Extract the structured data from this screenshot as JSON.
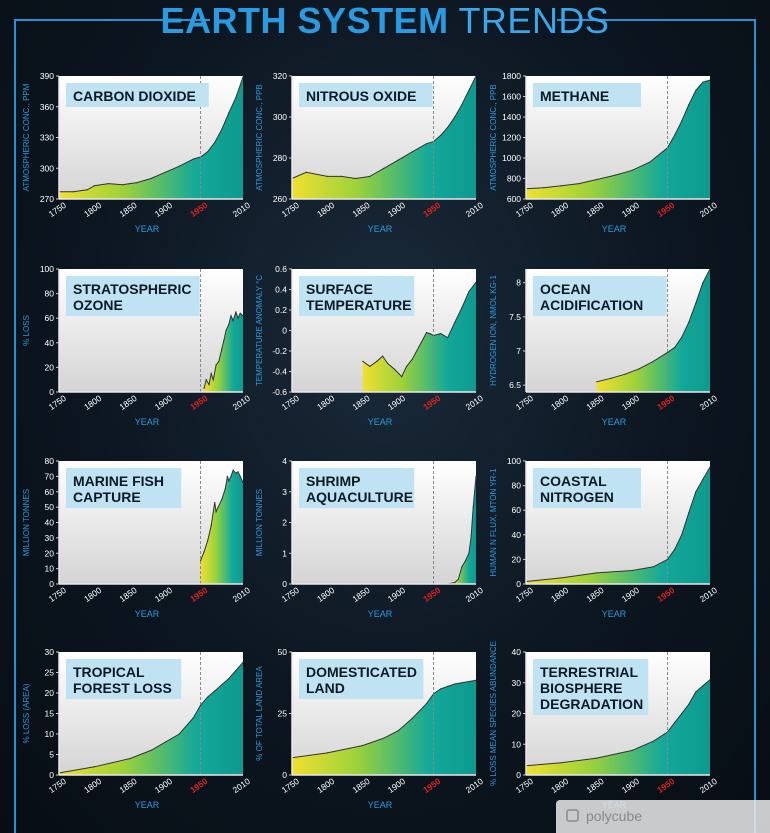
{
  "title_bold": "EARTH SYSTEM",
  "title_light": "TRENDS",
  "xlabel": "YEAR",
  "watermark": "polycube",
  "colors": {
    "accent": "#2e8fd0",
    "area_teal": "#12a89a",
    "area_yellow": "#f0e030",
    "highlight_year": "#e02020",
    "label_blue": "#2a9be0"
  },
  "chart_data": [
    {
      "type": "area",
      "title": [
        "CARBON DIOXIDE"
      ],
      "ylabel": "ATMOSPHERIC CONC., PPM",
      "xlim": [
        1750,
        2010
      ],
      "ylim": [
        270,
        390
      ],
      "yticks": [
        270,
        300,
        330,
        360,
        390
      ],
      "xticks": [
        1750,
        1800,
        1850,
        1900,
        1950,
        2010
      ],
      "x": [
        1750,
        1770,
        1790,
        1800,
        1820,
        1840,
        1860,
        1880,
        1900,
        1920,
        1940,
        1950,
        1960,
        1970,
        1980,
        1990,
        2000,
        2010
      ],
      "y": [
        277,
        277,
        279,
        283,
        285,
        284,
        286,
        290,
        296,
        302,
        309,
        311,
        316,
        325,
        338,
        354,
        369,
        389
      ]
    },
    {
      "type": "area",
      "title": [
        "NITROUS OXIDE"
      ],
      "ylabel": "ATMOSPHERIC CONC., PPB",
      "xlim": [
        1750,
        2010
      ],
      "ylim": [
        260,
        320
      ],
      "yticks": [
        260,
        280,
        300,
        320
      ],
      "xticks": [
        1750,
        1800,
        1850,
        1900,
        1950,
        2010
      ],
      "x": [
        1750,
        1770,
        1800,
        1820,
        1840,
        1860,
        1880,
        1900,
        1920,
        1940,
        1950,
        1960,
        1970,
        1980,
        1990,
        2000,
        2010
      ],
      "y": [
        270,
        273,
        271,
        271,
        270,
        271,
        275,
        279,
        283,
        287,
        288,
        291,
        295,
        300,
        306,
        313,
        322
      ]
    },
    {
      "type": "area",
      "title": [
        "METHANE"
      ],
      "ylabel": "ATMOSPHERIC CONC., PPB",
      "xlim": [
        1750,
        2010
      ],
      "ylim": [
        600,
        1800
      ],
      "yticks": [
        600,
        800,
        1000,
        1200,
        1400,
        1600,
        1800
      ],
      "xticks": [
        1750,
        1800,
        1850,
        1900,
        1950,
        2010
      ],
      "x": [
        1750,
        1775,
        1800,
        1825,
        1850,
        1875,
        1900,
        1925,
        1950,
        1960,
        1970,
        1980,
        1990,
        2000,
        2010
      ],
      "y": [
        700,
        710,
        730,
        750,
        790,
        830,
        880,
        960,
        1100,
        1220,
        1360,
        1520,
        1660,
        1740,
        1760
      ]
    },
    {
      "type": "area",
      "title": [
        "STRATOSPHERIC",
        "OZONE"
      ],
      "ylabel": "% LOSS",
      "xlim": [
        1750,
        2010
      ],
      "ylim": [
        0,
        100
      ],
      "yticks": [
        0,
        20,
        40,
        60,
        80,
        100
      ],
      "xticks": [
        1750,
        1800,
        1850,
        1900,
        1950,
        2010
      ],
      "x": [
        1955,
        1958,
        1962,
        1965,
        1968,
        1972,
        1976,
        1980,
        1983,
        1986,
        1990,
        1993,
        1996,
        2000,
        2003,
        2006,
        2010
      ],
      "y": [
        3,
        10,
        6,
        15,
        10,
        22,
        25,
        35,
        42,
        50,
        55,
        62,
        58,
        65,
        60,
        64,
        62
      ]
    },
    {
      "type": "area",
      "title": [
        "SURFACE",
        "TEMPERATURE"
      ],
      "ylabel": "TEMPERATURE ANOMALY °C",
      "xlim": [
        1750,
        2010
      ],
      "ylim": [
        -0.6,
        0.6
      ],
      "yticks": [
        -0.6,
        -0.4,
        -0.2,
        0,
        0.2,
        0.4,
        0.6
      ],
      "xticks": [
        1750,
        1800,
        1850,
        1900,
        1950,
        2010
      ],
      "x": [
        1850,
        1860,
        1870,
        1878,
        1885,
        1895,
        1905,
        1912,
        1920,
        1930,
        1940,
        1945,
        1950,
        1960,
        1970,
        1980,
        1990,
        2000,
        2010
      ],
      "y": [
        -0.3,
        -0.35,
        -0.3,
        -0.25,
        -0.32,
        -0.38,
        -0.45,
        -0.35,
        -0.28,
        -0.15,
        -0.02,
        -0.03,
        -0.05,
        -0.03,
        -0.07,
        0.08,
        0.22,
        0.38,
        0.47
      ]
    },
    {
      "type": "area",
      "title": [
        "OCEAN",
        "ACIDIFICATION"
      ],
      "ylabel": "HYDROGEN ION, NMOL KG-1",
      "xlim": [
        1750,
        2010
      ],
      "ylim": [
        6.4,
        8.2
      ],
      "yticks": [
        6.5,
        7.0,
        7.5,
        8.0
      ],
      "xticks": [
        1750,
        1800,
        1850,
        1900,
        1950,
        2010
      ],
      "x": [
        1850,
        1870,
        1890,
        1910,
        1930,
        1950,
        1960,
        1970,
        1980,
        1990,
        2000,
        2010
      ],
      "y": [
        6.55,
        6.6,
        6.66,
        6.74,
        6.85,
        6.98,
        7.05,
        7.2,
        7.42,
        7.7,
        8.0,
        8.3
      ]
    },
    {
      "type": "area",
      "title": [
        "MARINE FISH",
        "CAPTURE"
      ],
      "ylabel": "MILLION TONNES",
      "xlim": [
        1750,
        2010
      ],
      "ylim": [
        0,
        80
      ],
      "yticks": [
        0,
        10,
        20,
        30,
        40,
        50,
        60,
        70,
        80
      ],
      "xticks": [
        1750,
        1800,
        1850,
        1900,
        1950,
        2010
      ],
      "x": [
        1950,
        1955,
        1960,
        1965,
        1970,
        1972,
        1975,
        1980,
        1985,
        1988,
        1990,
        1993,
        1996,
        2000,
        2003,
        2006,
        2010
      ],
      "y": [
        15,
        21,
        28,
        38,
        53,
        47,
        50,
        55,
        62,
        70,
        67,
        70,
        74,
        72,
        73,
        70,
        66
      ]
    },
    {
      "type": "area",
      "title": [
        "SHRIMP",
        "AQUACULTURE"
      ],
      "ylabel": "MILLION TONNES",
      "xlim": [
        1750,
        2010
      ],
      "ylim": [
        0,
        4
      ],
      "yticks": [
        0,
        1,
        2,
        3,
        4
      ],
      "xticks": [
        1750,
        1800,
        1850,
        1900,
        1950,
        2010
      ],
      "x": [
        1970,
        1980,
        1985,
        1990,
        1995,
        2000,
        2003,
        2006,
        2008,
        2010
      ],
      "y": [
        0,
        0.05,
        0.15,
        0.55,
        0.75,
        1.0,
        1.5,
        2.5,
        3.0,
        3.5
      ]
    },
    {
      "type": "area",
      "title": [
        "COASTAL",
        "NITROGEN"
      ],
      "ylabel": "HUMAN N FLUX, MTON YR-1",
      "xlim": [
        1750,
        2010
      ],
      "ylim": [
        0,
        100
      ],
      "yticks": [
        0,
        20,
        40,
        60,
        80,
        100
      ],
      "xticks": [
        1750,
        1800,
        1850,
        1900,
        1950,
        2010
      ],
      "x": [
        1750,
        1800,
        1850,
        1900,
        1930,
        1950,
        1960,
        1970,
        1980,
        1990,
        2000,
        2010
      ],
      "y": [
        2,
        5,
        9,
        11,
        14,
        20,
        28,
        40,
        58,
        75,
        85,
        95
      ]
    },
    {
      "type": "area",
      "title": [
        "TROPICAL",
        "FOREST LOSS"
      ],
      "ylabel": "% LOSS (AREA)",
      "xlim": [
        1750,
        2010
      ],
      "ylim": [
        0,
        30
      ],
      "yticks": [
        0,
        5,
        10,
        15,
        20,
        25,
        30
      ],
      "xticks": [
        1750,
        1800,
        1850,
        1900,
        1950,
        2010
      ],
      "x": [
        1750,
        1800,
        1850,
        1880,
        1900,
        1920,
        1940,
        1950,
        1960,
        1970,
        1980,
        1990,
        2000,
        2010
      ],
      "y": [
        0.5,
        2,
        4,
        6,
        8,
        10,
        14,
        17,
        19,
        20.5,
        22,
        23.5,
        25.5,
        27.5
      ]
    },
    {
      "type": "area",
      "title": [
        "DOMESTICATED",
        "LAND"
      ],
      "ylabel": "% OF TOTAL LAND AREA",
      "xlim": [
        1750,
        2010
      ],
      "ylim": [
        0,
        50
      ],
      "yticks": [
        0,
        25,
        50
      ],
      "xticks": [
        1750,
        1800,
        1850,
        1900,
        1950,
        2010
      ],
      "x": [
        1750,
        1800,
        1850,
        1880,
        1900,
        1920,
        1940,
        1950,
        1960,
        1970,
        1980,
        1990,
        2000,
        2010
      ],
      "y": [
        7,
        9,
        12,
        15,
        18,
        23,
        29,
        33,
        35,
        36,
        37,
        37.5,
        38,
        38.5
      ]
    },
    {
      "type": "area",
      "title": [
        "TERRESTRIAL",
        "BIOSPHERE",
        "DEGRADATION"
      ],
      "ylabel": "% LOSS MEAN SPECIES ABUNDANCE",
      "xlim": [
        1750,
        2010
      ],
      "ylim": [
        0,
        40
      ],
      "yticks": [
        0,
        10,
        20,
        30,
        40
      ],
      "xticks": [
        1750,
        1800,
        1850,
        1900,
        1950,
        2010
      ],
      "x": [
        1750,
        1800,
        1850,
        1900,
        1930,
        1950,
        1960,
        1970,
        1980,
        1990,
        2000,
        2010
      ],
      "y": [
        3,
        4,
        5.5,
        8,
        11,
        14,
        17,
        20,
        23,
        27,
        29,
        31
      ]
    }
  ]
}
